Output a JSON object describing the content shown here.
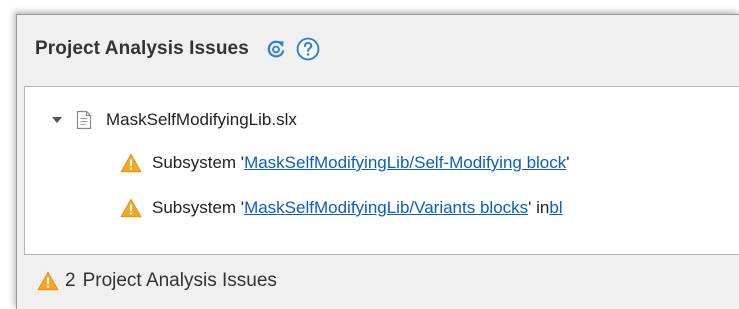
{
  "panel": {
    "title": "Project Analysis Issues",
    "refresh_icon": "refresh-icon",
    "help_icon": "help-icon"
  },
  "tree": {
    "root": {
      "label": "MaskSelfModifyingLib.slx",
      "expanded": true,
      "icon": "file-icon"
    },
    "issues": [
      {
        "prefix": "Subsystem '",
        "link": "MaskSelfModifyingLib/Self-Modifying block",
        "suffix": "'",
        "link2": "",
        "icon": "warning-icon"
      },
      {
        "prefix": "Subsystem '",
        "link": "MaskSelfModifyingLib/Variants blocks",
        "suffix": "' in ",
        "link2": "bl",
        "icon": "warning-icon"
      }
    ]
  },
  "footer": {
    "count": "2",
    "label": "Project Analysis Issues",
    "icon": "warning-icon"
  },
  "colors": {
    "panel_bg": "#f0f0f0",
    "link": "#0b5fbe",
    "warning": "#f5a623",
    "button_blue": "#2f80d1"
  }
}
